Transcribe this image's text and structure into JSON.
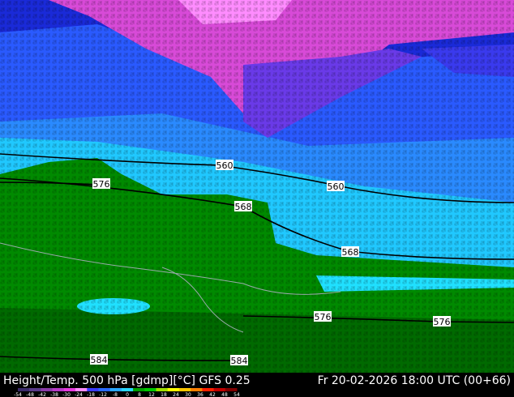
{
  "footer": {
    "left": "Height/Temp. 500 hPa [gdmp][°C] GFS 0.25",
    "right": "Fr 20-02-2026 18:00 UTC (00+66)"
  },
  "contour_labels": [
    "560",
    "568",
    "576",
    "584"
  ],
  "colorbar": {
    "ticks": [
      "-54",
      "-48",
      "-42",
      "-38",
      "-30",
      "-24",
      "-18",
      "-12",
      "-8",
      "0",
      "8",
      "12",
      "18",
      "24",
      "30",
      "36",
      "42",
      "48",
      "54"
    ],
    "colors": [
      "#3a2a6a",
      "#5a3a8a",
      "#8a3aa8",
      "#b83ac8",
      "#e83ae0",
      "#ff8cff",
      "#3a3aff",
      "#2a6aff",
      "#2aa8ff",
      "#2ad8ff",
      "#00a000",
      "#00c800",
      "#a0e000",
      "#ffff00",
      "#ffc800",
      "#ff8000",
      "#ff2000",
      "#c00000",
      "#800000"
    ]
  },
  "colors": {
    "deep_blue": "#1a2ad8",
    "mid_blue": "#2a5aff",
    "light_blue": "#2aa8ff",
    "cyan": "#20e0ff",
    "magenta": "#e84ae8",
    "violet": "#ff8cff",
    "green": "#008a00",
    "dark_green": "#006a00"
  }
}
